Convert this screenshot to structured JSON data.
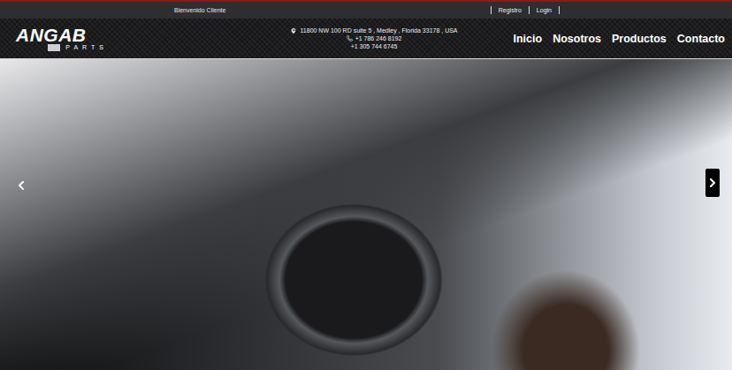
{
  "top_bar": {
    "greeting": "Bienvenido Cliente",
    "links": [
      {
        "label": "Registro"
      },
      {
        "label": "Login"
      }
    ]
  },
  "header": {
    "logo": {
      "name": "ANGAB",
      "sub": "PARTS"
    },
    "address": "11800 NW 100 RD suite 5 , Medley , Florida 33178 , USA",
    "phones": [
      "+1 786 246 8192",
      "+1 305 744 6745"
    ],
    "nav": [
      {
        "label": "Inicio"
      },
      {
        "label": "Nosotros"
      },
      {
        "label": "Productos"
      },
      {
        "label": "Contacto"
      }
    ]
  },
  "hero": {
    "slide": "photo"
  }
}
